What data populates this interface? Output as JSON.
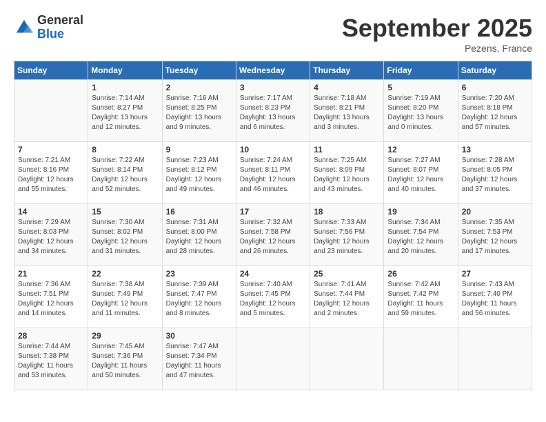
{
  "logo": {
    "general": "General",
    "blue": "Blue"
  },
  "title": "September 2025",
  "location": "Pezens, France",
  "headers": [
    "Sunday",
    "Monday",
    "Tuesday",
    "Wednesday",
    "Thursday",
    "Friday",
    "Saturday"
  ],
  "weeks": [
    [
      {
        "day": "",
        "info": ""
      },
      {
        "day": "1",
        "info": "Sunrise: 7:14 AM\nSunset: 8:27 PM\nDaylight: 13 hours\nand 12 minutes."
      },
      {
        "day": "2",
        "info": "Sunrise: 7:16 AM\nSunset: 8:25 PM\nDaylight: 13 hours\nand 9 minutes."
      },
      {
        "day": "3",
        "info": "Sunrise: 7:17 AM\nSunset: 8:23 PM\nDaylight: 13 hours\nand 6 minutes."
      },
      {
        "day": "4",
        "info": "Sunrise: 7:18 AM\nSunset: 8:21 PM\nDaylight: 13 hours\nand 3 minutes."
      },
      {
        "day": "5",
        "info": "Sunrise: 7:19 AM\nSunset: 8:20 PM\nDaylight: 13 hours\nand 0 minutes."
      },
      {
        "day": "6",
        "info": "Sunrise: 7:20 AM\nSunset: 8:18 PM\nDaylight: 12 hours\nand 57 minutes."
      }
    ],
    [
      {
        "day": "7",
        "info": "Sunrise: 7:21 AM\nSunset: 8:16 PM\nDaylight: 12 hours\nand 55 minutes."
      },
      {
        "day": "8",
        "info": "Sunrise: 7:22 AM\nSunset: 8:14 PM\nDaylight: 12 hours\nand 52 minutes."
      },
      {
        "day": "9",
        "info": "Sunrise: 7:23 AM\nSunset: 8:12 PM\nDaylight: 12 hours\nand 49 minutes."
      },
      {
        "day": "10",
        "info": "Sunrise: 7:24 AM\nSunset: 8:11 PM\nDaylight: 12 hours\nand 46 minutes."
      },
      {
        "day": "11",
        "info": "Sunrise: 7:25 AM\nSunset: 8:09 PM\nDaylight: 12 hours\nand 43 minutes."
      },
      {
        "day": "12",
        "info": "Sunrise: 7:27 AM\nSunset: 8:07 PM\nDaylight: 12 hours\nand 40 minutes."
      },
      {
        "day": "13",
        "info": "Sunrise: 7:28 AM\nSunset: 8:05 PM\nDaylight: 12 hours\nand 37 minutes."
      }
    ],
    [
      {
        "day": "14",
        "info": "Sunrise: 7:29 AM\nSunset: 8:03 PM\nDaylight: 12 hours\nand 34 minutes."
      },
      {
        "day": "15",
        "info": "Sunrise: 7:30 AM\nSunset: 8:02 PM\nDaylight: 12 hours\nand 31 minutes."
      },
      {
        "day": "16",
        "info": "Sunrise: 7:31 AM\nSunset: 8:00 PM\nDaylight: 12 hours\nand 28 minutes."
      },
      {
        "day": "17",
        "info": "Sunrise: 7:32 AM\nSunset: 7:58 PM\nDaylight: 12 hours\nand 26 minutes."
      },
      {
        "day": "18",
        "info": "Sunrise: 7:33 AM\nSunset: 7:56 PM\nDaylight: 12 hours\nand 23 minutes."
      },
      {
        "day": "19",
        "info": "Sunrise: 7:34 AM\nSunset: 7:54 PM\nDaylight: 12 hours\nand 20 minutes."
      },
      {
        "day": "20",
        "info": "Sunrise: 7:35 AM\nSunset: 7:53 PM\nDaylight: 12 hours\nand 17 minutes."
      }
    ],
    [
      {
        "day": "21",
        "info": "Sunrise: 7:36 AM\nSunset: 7:51 PM\nDaylight: 12 hours\nand 14 minutes."
      },
      {
        "day": "22",
        "info": "Sunrise: 7:38 AM\nSunset: 7:49 PM\nDaylight: 12 hours\nand 11 minutes."
      },
      {
        "day": "23",
        "info": "Sunrise: 7:39 AM\nSunset: 7:47 PM\nDaylight: 12 hours\nand 8 minutes."
      },
      {
        "day": "24",
        "info": "Sunrise: 7:40 AM\nSunset: 7:45 PM\nDaylight: 12 hours\nand 5 minutes."
      },
      {
        "day": "25",
        "info": "Sunrise: 7:41 AM\nSunset: 7:44 PM\nDaylight: 12 hours\nand 2 minutes."
      },
      {
        "day": "26",
        "info": "Sunrise: 7:42 AM\nSunset: 7:42 PM\nDaylight: 11 hours\nand 59 minutes."
      },
      {
        "day": "27",
        "info": "Sunrise: 7:43 AM\nSunset: 7:40 PM\nDaylight: 11 hours\nand 56 minutes."
      }
    ],
    [
      {
        "day": "28",
        "info": "Sunrise: 7:44 AM\nSunset: 7:38 PM\nDaylight: 11 hours\nand 53 minutes."
      },
      {
        "day": "29",
        "info": "Sunrise: 7:45 AM\nSunset: 7:36 PM\nDaylight: 11 hours\nand 50 minutes."
      },
      {
        "day": "30",
        "info": "Sunrise: 7:47 AM\nSunset: 7:34 PM\nDaylight: 11 hours\nand 47 minutes."
      },
      {
        "day": "",
        "info": ""
      },
      {
        "day": "",
        "info": ""
      },
      {
        "day": "",
        "info": ""
      },
      {
        "day": "",
        "info": ""
      }
    ]
  ]
}
